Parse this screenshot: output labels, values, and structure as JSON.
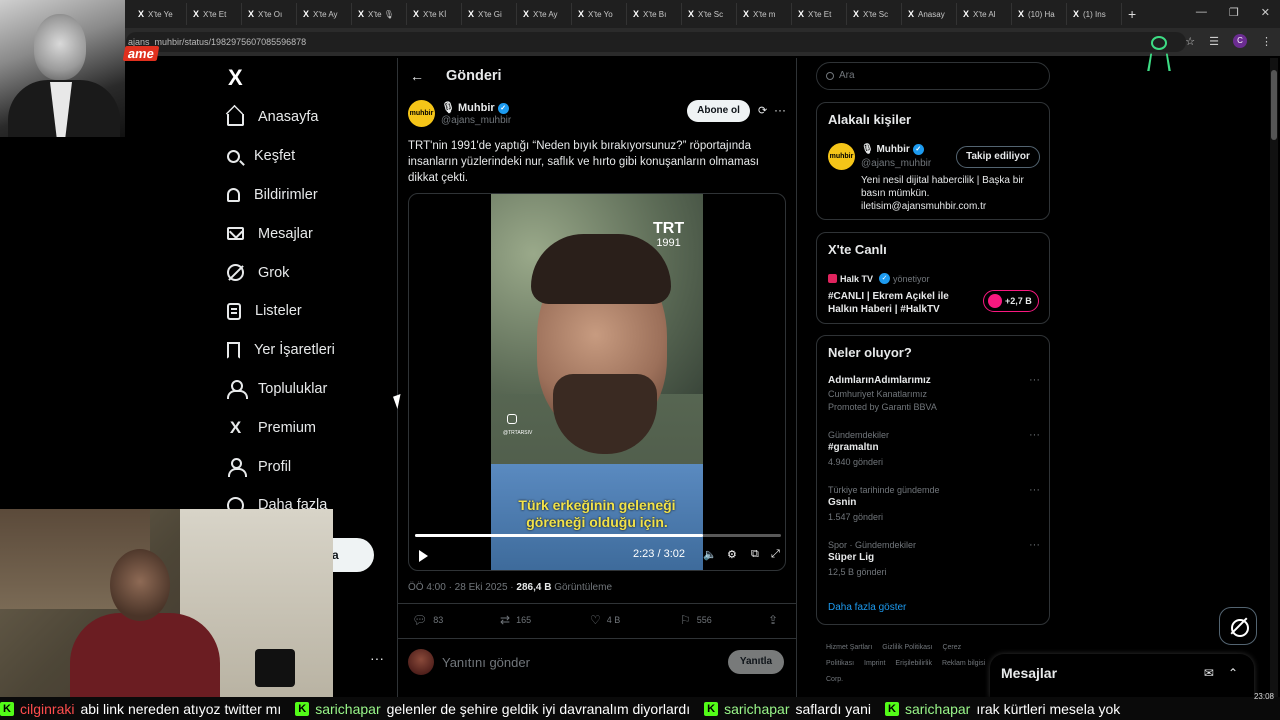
{
  "browser": {
    "tabs": [
      {
        "label": "X'te Ye"
      },
      {
        "label": "X'te Et"
      },
      {
        "label": "X'te Oı"
      },
      {
        "label": "X'te Ay"
      },
      {
        "label": "X'te 🎙"
      },
      {
        "label": "X'te Kİ"
      },
      {
        "label": "X'te Gi"
      },
      {
        "label": "X'te Ay"
      },
      {
        "label": "X'te Yo"
      },
      {
        "label": "X'te Bı"
      },
      {
        "label": "X'te Sc"
      },
      {
        "label": "X'te m"
      },
      {
        "label": "X'te Et"
      },
      {
        "label": "X'te Sc"
      },
      {
        "label": "Anasay"
      },
      {
        "label": "X'te Al"
      },
      {
        "label": "(10) Ha"
      },
      {
        "label": "(1) Ins"
      }
    ],
    "new_tab": "+",
    "url": "ajans_muhbir/status/1982975607085596878",
    "profile_initial": "C",
    "brand_fragment": "ame"
  },
  "nav": {
    "logo": "X",
    "items": [
      {
        "label": "Anasayfa",
        "icon": "home-icon"
      },
      {
        "label": "Keşfet",
        "icon": "search-icon"
      },
      {
        "label": "Bildirimler",
        "icon": "bell-icon"
      },
      {
        "label": "Mesajlar",
        "icon": "mail-icon"
      },
      {
        "label": "Grok",
        "icon": "grok-icon"
      },
      {
        "label": "Listeler",
        "icon": "list-icon"
      },
      {
        "label": "Yer İşaretleri",
        "icon": "bookmark-icon"
      },
      {
        "label": "Topluluklar",
        "icon": "communities-icon"
      },
      {
        "label": "Premium",
        "icon": "x-icon"
      },
      {
        "label": "Profil",
        "icon": "profile-icon"
      },
      {
        "label": "Daha fazla",
        "icon": "more-circle-icon"
      }
    ],
    "post_button_fragment": "a",
    "more_dots": "···"
  },
  "main": {
    "title": "Gönderi",
    "author": {
      "avatar_text": "muhbir",
      "name": "🎙 Muhbir",
      "handle": "@ajans_muhbir",
      "subscribe_label": "Abone ol"
    },
    "text": "TRT'nin 1991'de yaptığı “Neden bıyık bırakıyorsunuz?” röportajında insanların yüzlerindeki nur, saflık ve hırto gibi konuşanların olmaması dikkat çekti.",
    "video": {
      "watermark_brand": "TRT",
      "watermark_year": "1991",
      "insta_handle": "@TRTARSIV",
      "subtitle_line1": "Türk erkeğinin geleneği",
      "subtitle_line2": "göreneği olduğu için.",
      "time": "2:23 / 3:02",
      "progress": 0.786
    },
    "meta": {
      "time_date": "ÖÖ 4:00 · 28 Eki 2025 · ",
      "views_count": "286,4 B",
      "views_label": " Görüntüleme"
    },
    "actions": {
      "replies": "83",
      "reposts": "165",
      "likes": "4 B",
      "bookmarks": "556"
    },
    "reply": {
      "placeholder": "Yanıtını gönder",
      "button": "Yanıtla"
    }
  },
  "right": {
    "search_placeholder": "Ara",
    "related": {
      "title": "Alakalı kişiler",
      "avatar_text": "muhbir",
      "name": "🎙 Muhbir",
      "handle": "@ajans_muhbir",
      "follow_label": "Takip ediliyor",
      "bio": "Yeni nesil dijital habercilik | Başka bir basın mümkün. iletisim@ajansmuhbir.com.tr"
    },
    "live": {
      "title": "X'te Canlı",
      "host": "Halk TV",
      "role": "yönetiyor",
      "stream_title": "#CANLI | Ekrem Açıkel ile Halkın Haberi | #HalkTV",
      "listeners": "+2,7 B"
    },
    "trends": {
      "title": "Neler oluyor?",
      "items": [
        {
          "category": "",
          "name": "AdımlarınAdımlarımız",
          "sub": "Cumhuriyet Kanatlarımız",
          "count": "Promoted by Garanti BBVA"
        },
        {
          "category": "Gündemdekiler",
          "name": "#gramaltın",
          "sub": "",
          "count": "4.940 gönderi"
        },
        {
          "category": "Türkiye tarihinde gündemde",
          "name": "Gsnin",
          "sub": "",
          "count": "1.547 gönderi"
        },
        {
          "category": "Spor · Gündemdekiler",
          "name": "Süper Lig",
          "sub": "",
          "count": "12,5 B gönderi"
        }
      ],
      "show_more": "Daha fazla göster"
    },
    "footer": [
      "Hizmet Şartları",
      "Gizlilik Politikası",
      "Çerez Politikası",
      "Imprint",
      "Erişilebilirlik",
      "Reklam bilgisi",
      "© 2025 X Corp."
    ]
  },
  "dm": {
    "title": "Mesajlar"
  },
  "stream_chat": [
    {
      "user": "cilginraki",
      "message": "abi link nereden atıyoz twitter mı",
      "user_color": "red"
    },
    {
      "user": "sarichapar",
      "message": "gelenler de şehire geldik iyi davranalım diyorlardı",
      "user_color": "green"
    },
    {
      "user": "sarichapar",
      "message": "saflardı yani",
      "user_color": "green"
    },
    {
      "user": "sarichapar",
      "message": "ırak kürtleri mesela yok",
      "user_color": "green"
    }
  ],
  "clock": "23:08",
  "colors": {
    "accent": "#1d9bf0",
    "kick_green": "#53fc18",
    "live_pink": "#f91880"
  }
}
